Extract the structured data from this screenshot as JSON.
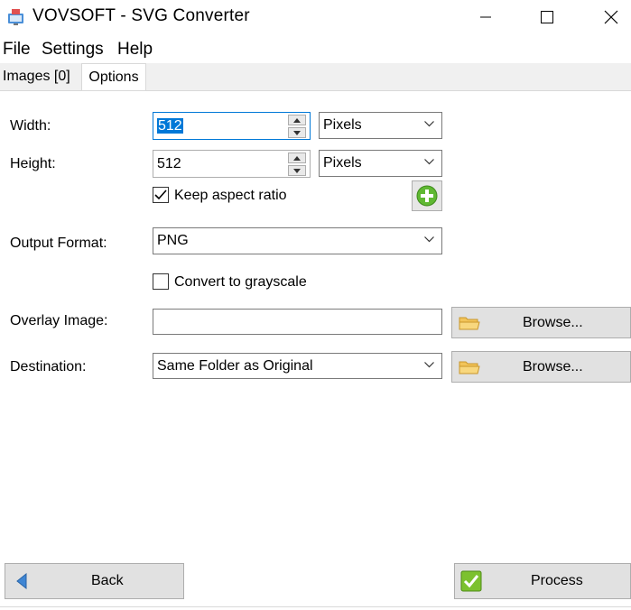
{
  "window": {
    "title": "VOVSOFT - SVG Converter",
    "controls": [
      "minimize",
      "maximize",
      "close"
    ]
  },
  "menu": {
    "file": "File",
    "settings": "Settings",
    "help": "Help"
  },
  "tabs": {
    "images": "Images [0]",
    "options": "Options",
    "active": "Options"
  },
  "options": {
    "width_label": "Width:",
    "width_value": "512",
    "width_unit": "Pixels",
    "height_label": "Height:",
    "height_value": "512",
    "height_unit": "Pixels",
    "keep_aspect_label": "Keep aspect ratio",
    "keep_aspect_checked": true,
    "output_format_label": "Output Format:",
    "output_format_value": "PNG",
    "grayscale_label": "Convert to grayscale",
    "grayscale_checked": false,
    "overlay_label": "Overlay Image:",
    "overlay_value": "",
    "overlay_browse": "Browse...",
    "destination_label": "Destination:",
    "destination_value": "Same Folder as Original",
    "destination_browse": "Browse..."
  },
  "footer": {
    "back_label": "Back",
    "process_label": "Process"
  },
  "colors": {
    "accent": "#0078d7",
    "button_face": "#e1e1e1",
    "add_green": "#4caf50",
    "process_green": "#7cc12f"
  },
  "icons": [
    "app-icon",
    "minimize-icon",
    "maximize-icon",
    "close-icon",
    "chevron-down-icon",
    "add-icon",
    "folder-icon",
    "back-arrow-icon",
    "checkmark-icon"
  ]
}
